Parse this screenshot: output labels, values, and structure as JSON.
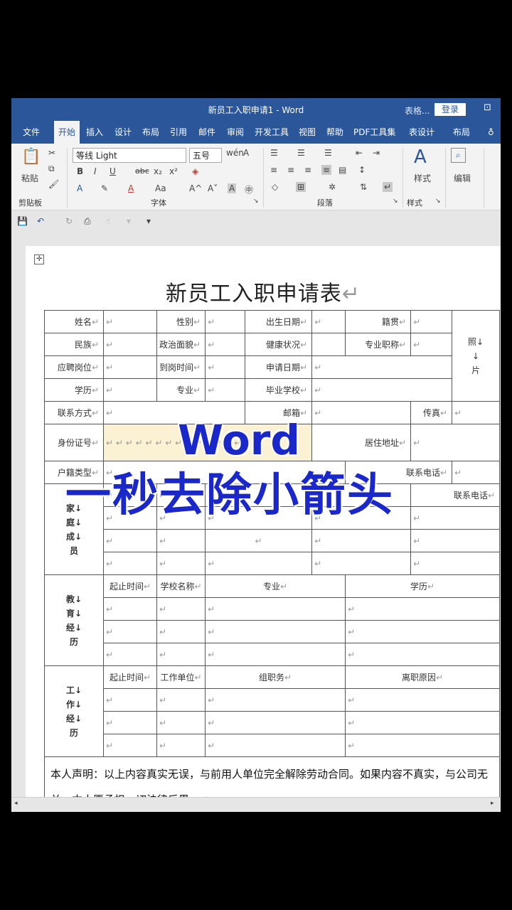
{
  "window": {
    "title": "新员工入职申请1  -  Word",
    "table_tools": "表格...",
    "login": "登录"
  },
  "tabs": [
    "文件",
    "开始",
    "插入",
    "设计",
    "布局",
    "引用",
    "邮件",
    "审阅",
    "开发工具",
    "视图",
    "帮助",
    "PDF工具集",
    "表设计",
    "布局"
  ],
  "ribbon": {
    "clipboard": {
      "label": "剪贴板",
      "paste": "粘贴"
    },
    "font": {
      "label": "字体",
      "font_name": "等线 Light",
      "font_size": "五号",
      "bold": "B",
      "italic": "I",
      "underline": "U",
      "strike": "abc",
      "sub": "x₂",
      "sup": "x²",
      "grow": "A^",
      "shrink": "A˅",
      "case": "Aa"
    },
    "paragraph": {
      "label": "段落"
    },
    "styles": {
      "label": "样式",
      "btn": "样式"
    },
    "editing": {
      "btn": "编辑"
    }
  },
  "doc": {
    "title": "新员工入职申请表",
    "rows": {
      "r1": [
        "姓名",
        "性别",
        "出生日期",
        "籍贯"
      ],
      "r2": [
        "民族",
        "政治面貌",
        "健康状况",
        "专业职称"
      ],
      "r3": [
        "应聘岗位",
        "到岗时间",
        "申请日期"
      ],
      "r4": [
        "学历",
        "专业",
        "毕业学校"
      ],
      "r5": [
        "联系方式",
        "邮箱",
        "传真"
      ],
      "r6": [
        "身份证号",
        "居住地址"
      ],
      "r7": [
        "户籍类型",
        "联系电话"
      ],
      "photo": "照↓\n↓\n片"
    },
    "family": {
      "label": "家↓\n庭↓\n成↓\n员",
      "header": [
        "联系电话"
      ]
    },
    "education": {
      "label": "教↓\n育↓\n经↓\n历",
      "header": [
        "起止时间",
        "学校名称",
        "专业",
        "学历"
      ]
    },
    "work": {
      "label": "工↓\n作↓\n经↓\n历",
      "header": [
        "起止时间",
        "工作单位",
        "组职务",
        "离职原因"
      ]
    },
    "declaration": "本人声明：以上内容真实无误，与前用人单位完全解除劳动合同。如果内容不真实，与公司无关，本人愿承担一切法律后果。"
  },
  "overlay": {
    "line1": "Word",
    "line2": "一秒去除小箭头"
  }
}
